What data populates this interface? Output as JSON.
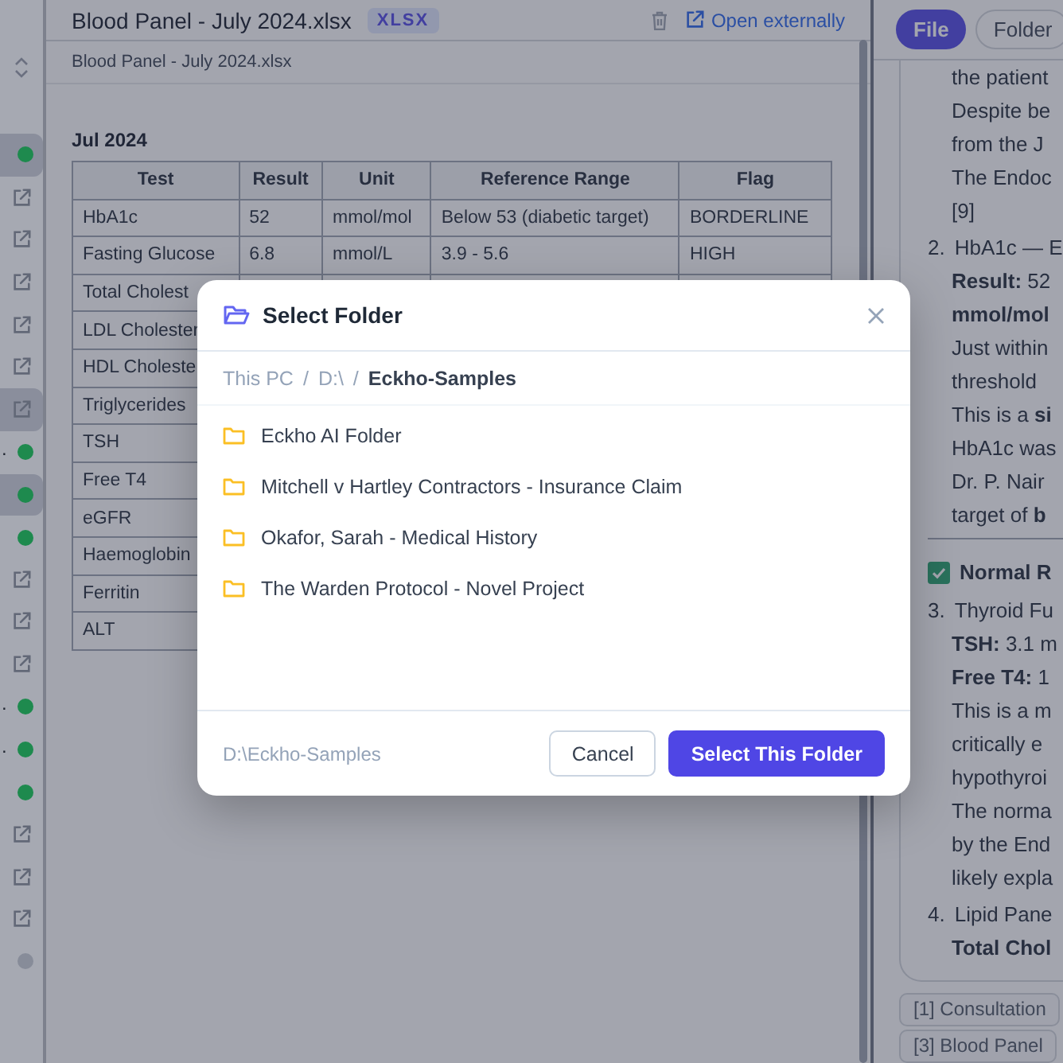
{
  "sidebar": {
    "items": [
      {
        "kind": "dot",
        "color": "#1e8a4e",
        "selected": true
      },
      {
        "kind": "link",
        "selected": false
      },
      {
        "kind": "link",
        "selected": false
      },
      {
        "kind": "link",
        "selected": false
      },
      {
        "kind": "link",
        "selected": false
      },
      {
        "kind": "link",
        "selected": false
      },
      {
        "kind": "link",
        "selected": true
      },
      {
        "kind": "dot",
        "color": "#1e8a4e",
        "selected": false,
        "tail": "."
      },
      {
        "kind": "dot",
        "color": "#1e8a4e",
        "selected": true
      },
      {
        "kind": "dot",
        "color": "#1e8a4e",
        "selected": false
      },
      {
        "kind": "link",
        "selected": false
      },
      {
        "kind": "link",
        "selected": false
      },
      {
        "kind": "link",
        "selected": false
      },
      {
        "kind": "dot",
        "color": "#1e8a4e",
        "selected": false,
        "tail": "."
      },
      {
        "kind": "dot",
        "color": "#1e8a4e",
        "selected": false,
        "tail": "."
      },
      {
        "kind": "dot",
        "color": "#1e8a4e",
        "selected": false
      },
      {
        "kind": "link",
        "selected": false
      },
      {
        "kind": "link",
        "selected": false
      },
      {
        "kind": "link",
        "selected": false
      },
      {
        "kind": "dot",
        "color": "#878c99",
        "selected": false
      }
    ]
  },
  "document": {
    "title": "Blood Panel - July 2024.xlsx",
    "badge": "XLSX",
    "open_link": "Open externally",
    "file_name": "Blood Panel - July 2024.xlsx",
    "sheet_title": "Jul 2024",
    "table": {
      "columns": [
        "Test",
        "Result",
        "Unit",
        "Reference Range",
        "Flag"
      ],
      "rows": [
        [
          "HbA1c",
          "52",
          "mmol/mol",
          "Below 53 (diabetic target)",
          "BORDERLINE"
        ],
        [
          "Fasting Glucose",
          "6.8",
          "mmol/L",
          "3.9 - 5.6",
          "HIGH"
        ],
        [
          "Total Cholest"
        ],
        [
          "LDL Cholester"
        ],
        [
          "HDL Choleste"
        ],
        [
          "Triglycerides"
        ],
        [
          "TSH"
        ],
        [
          "Free T4"
        ],
        [
          "eGFR"
        ],
        [
          "Haemoglobin"
        ],
        [
          "Ferritin"
        ],
        [
          "ALT"
        ]
      ]
    }
  },
  "chat": {
    "tabs": [
      {
        "label": "File",
        "selected": true
      },
      {
        "label": "Folder",
        "selected": false
      }
    ],
    "lines": [
      {
        "kind": "para",
        "text": "the patient"
      },
      {
        "kind": "para",
        "text": "Despite be"
      },
      {
        "kind": "para",
        "text": "from the J"
      },
      {
        "kind": "para",
        "text": "The Endoc"
      },
      {
        "kind": "para",
        "text": "[9]"
      },
      {
        "kind": "item",
        "number": "2.",
        "text": "HbA1c — E"
      },
      {
        "kind": "para",
        "text": "**Result:** 52"
      },
      {
        "kind": "para",
        "text": "**mmol/mol**"
      },
      {
        "kind": "para",
        "text": "Just within"
      },
      {
        "kind": "para",
        "text": "threshold"
      },
      {
        "kind": "para",
        "text": "This is a **si**"
      },
      {
        "kind": "para",
        "text": "HbA1c was"
      },
      {
        "kind": "para",
        "text": "Dr. P. Nair"
      },
      {
        "kind": "para",
        "text": "target of **b**"
      },
      {
        "kind": "rule"
      },
      {
        "kind": "heading",
        "text": "Normal R"
      },
      {
        "kind": "item",
        "number": "3.",
        "text": "Thyroid Fu"
      },
      {
        "kind": "para",
        "text": "**TSH:** 3.1 m"
      },
      {
        "kind": "para",
        "text": "**Free T4:** 1"
      },
      {
        "kind": "para",
        "text": "This is a m"
      },
      {
        "kind": "para",
        "text": "critically e"
      },
      {
        "kind": "para",
        "text": "hypothyroi"
      },
      {
        "kind": "para",
        "text": "The norma"
      },
      {
        "kind": "para",
        "text": "by the End"
      },
      {
        "kind": "para",
        "text": "likely expla"
      },
      {
        "kind": "item",
        "number": "4.",
        "text": "Lipid Pane"
      },
      {
        "kind": "strong",
        "text": "Total Chol"
      }
    ],
    "citations": [
      "[1] Consultation",
      "[3] Blood Panel"
    ]
  },
  "dialog": {
    "title": "Select Folder",
    "breadcrumb_separator": "/",
    "breadcrumb": [
      {
        "label": "This PC",
        "current": false
      },
      {
        "label": "D:\\",
        "current": false
      },
      {
        "label": "Eckho-Samples",
        "current": true
      }
    ],
    "folders": [
      "Eckho AI Folder",
      "Mitchell v Hartley Contractors - Insurance Claim",
      "Okafor, Sarah - Medical History",
      "The Warden Protocol - Novel Project"
    ],
    "path": "D:\\Eckho-Samples",
    "buttons": [
      {
        "label": "Cancel",
        "kind": "secondary"
      },
      {
        "label": "Select This Folder",
        "kind": "primary"
      }
    ]
  }
}
